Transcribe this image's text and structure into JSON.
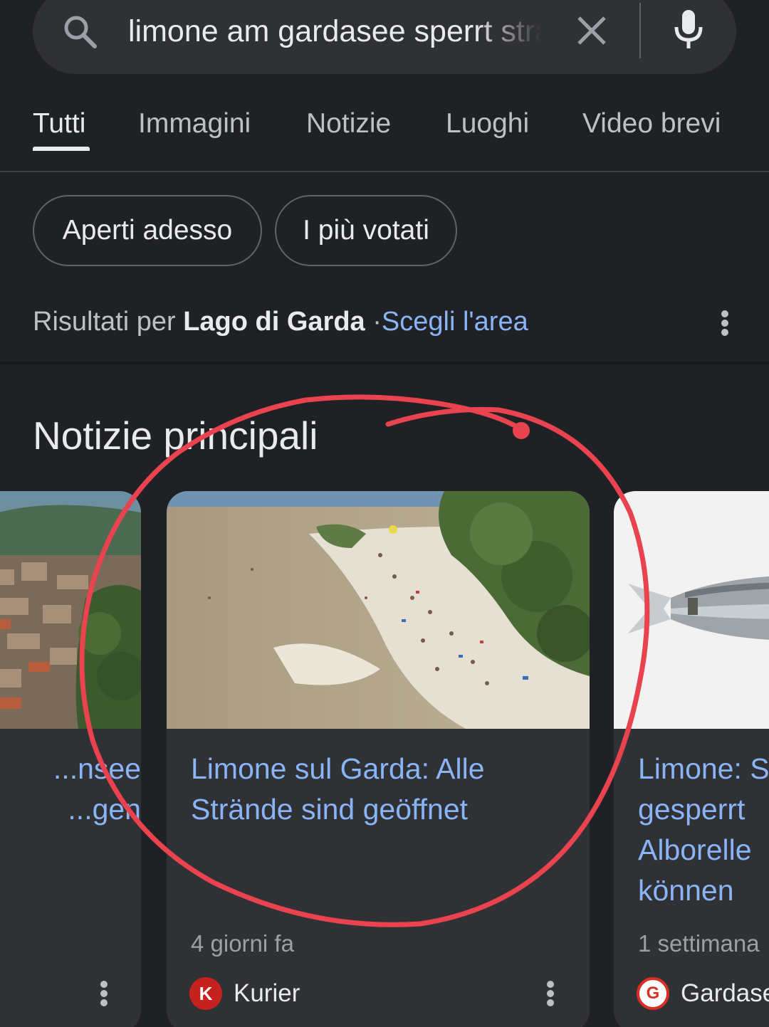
{
  "search": {
    "query": "limone am gardasee sperrt strände",
    "icons": {
      "search": "search-icon",
      "clear": "close-icon",
      "voice": "mic-icon"
    }
  },
  "tabs": [
    {
      "label": "Tutti",
      "active": true
    },
    {
      "label": "Immagini",
      "active": false
    },
    {
      "label": "Notizie",
      "active": false
    },
    {
      "label": "Luoghi",
      "active": false
    },
    {
      "label": "Video brevi",
      "active": false
    }
  ],
  "chips": [
    {
      "label": "Aperti adesso"
    },
    {
      "label": "I più votati"
    }
  ],
  "results_for": {
    "prefix": "Risultati per",
    "location": "Lago di Garda",
    "separator": "·",
    "choose_area": "Scegli l'area"
  },
  "top_news": {
    "title": "Notizie principali",
    "cards": [
      {
        "title_line1": "...nsee",
        "title_line2": "...gen",
        "image": "aerial-town-photo"
      },
      {
        "title_line1": "Limone sul Garda: Alle",
        "title_line2": "Strände sind geöffnet",
        "time": "4 giorni fa",
        "source": "Kurier",
        "source_logo_letter": "K",
        "image": "crowded-beach-photo"
      },
      {
        "title_line1": "Limone: S",
        "title_line2": "gesperrt",
        "title_line3": "Alborelle",
        "title_line4": "können",
        "time": "1 settimana",
        "source": "Gardase",
        "source_logo_letter": "G",
        "image": "fish-photo"
      }
    ]
  },
  "colors": {
    "background": "#202124",
    "surface": "#303134",
    "link": "#8ab4f8",
    "annotation": "#e8434e"
  }
}
